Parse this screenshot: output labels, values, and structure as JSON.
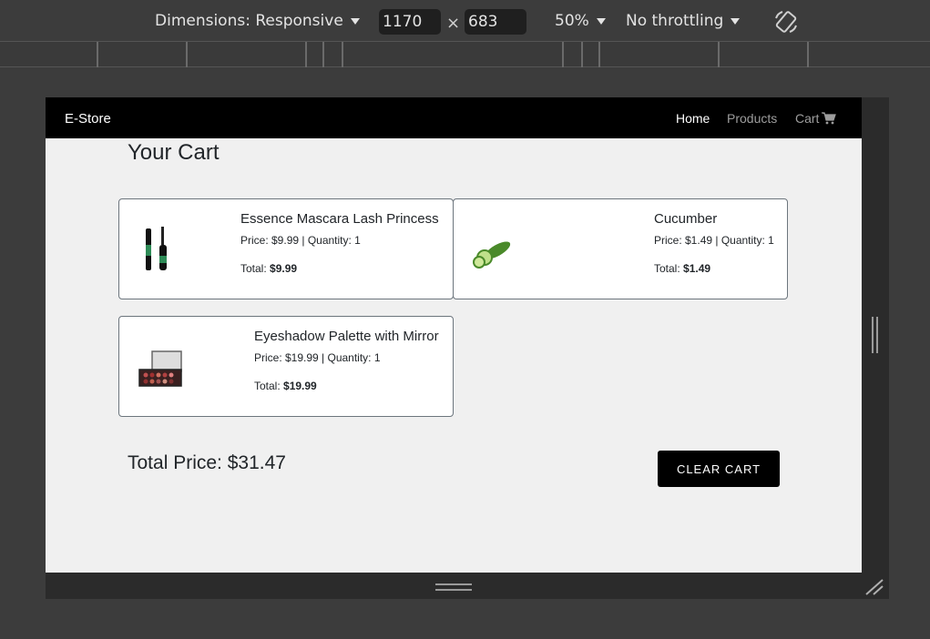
{
  "devtools": {
    "dimensions_label": "Dimensions: Responsive",
    "width_value": "1170",
    "height_value": "683",
    "times": "×",
    "zoom_label": "50%",
    "throttling_label": "No throttling",
    "rotate_icon": "rotate-icon"
  },
  "nav": {
    "brand": "E-Store",
    "home": "Home",
    "products": "Products",
    "cart": "Cart",
    "cart_icon": "shopping-cart-icon"
  },
  "page": {
    "title": "Your Cart",
    "total_price": "Total Price: $31.47",
    "clear_cart": "CLEAR CART"
  },
  "cart": {
    "items": [
      {
        "name": "Essence Mascara Lash Princess",
        "price_qty": "Price: $9.99 | Quantity: 1",
        "total_label": "Total: ",
        "total_value": "$9.99",
        "image_icon": "mascara-icon"
      },
      {
        "name": "Cucumber",
        "price_qty": "Price: $1.49 | Quantity: 1",
        "total_label": "Total: ",
        "total_value": "$1.49",
        "image_icon": "cucumber-icon"
      },
      {
        "name": "Eyeshadow Palette with Mirror",
        "price_qty": "Price: $19.99 | Quantity: 1",
        "total_label": "Total: ",
        "total_value": "$19.99",
        "image_icon": "eyeshadow-palette-icon"
      }
    ]
  },
  "colors": {
    "navbar": "#000000",
    "page_background": "#f0f0f0",
    "button": "#000000",
    "devtools_background": "#3c3c3c"
  }
}
